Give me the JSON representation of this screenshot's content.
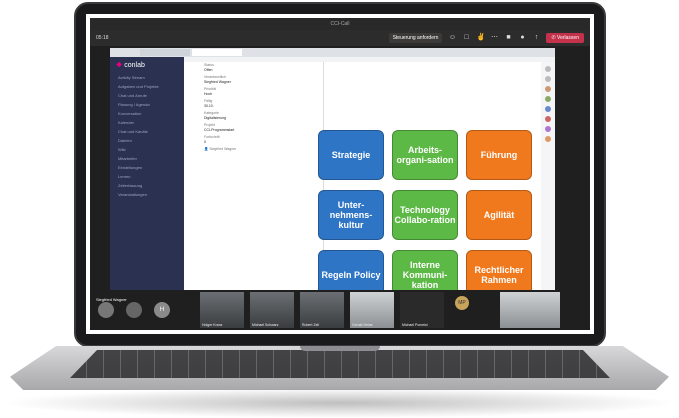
{
  "window": {
    "title": "CCI-Call"
  },
  "meeting_bar": {
    "timer": "05:18",
    "request_control_label": "Steuerung anfordern",
    "leave_label": "Verlassen"
  },
  "conlab": {
    "logo": "conlab",
    "nav_items": [
      "Activity Stream",
      "Aufgaben und Projekte",
      "Chat und Anrufe",
      "Planung / Agenda",
      "Konversation",
      "Kalender",
      "Chat und Kanäle",
      "Dateien",
      "Wiki",
      "Mitarbeiter",
      "Einstellungen",
      "Lernen",
      "Zeiterfassung",
      "Veranstaltungen"
    ]
  },
  "panel": {
    "rows": [
      {
        "label": "Status",
        "value": "Offen"
      },
      {
        "label": "Verantwortlich",
        "value": "Siegfried Wagner"
      },
      {
        "label": "Priorität",
        "value": "Hoch"
      },
      {
        "label": "Fällig",
        "value": "30.10."
      },
      {
        "label": "Kategorie",
        "value": "Digitalisierung"
      },
      {
        "label": "Projekt",
        "value": "CCI-Programmstart"
      },
      {
        "label": "Fortschritt",
        "value": "0"
      }
    ],
    "assignee": "Siegfried Wagner"
  },
  "slide": {
    "tiles": [
      {
        "text": "Strategie",
        "color": "#2e75c5"
      },
      {
        "text": "Arbeits-organi-sation",
        "color": "#5db945"
      },
      {
        "text": "Führung",
        "color": "#f0791d"
      },
      {
        "text": "Unter-nehmens-kultur",
        "color": "#2e75c5"
      },
      {
        "text": "Technology Collabo-ration",
        "color": "#5db945"
      },
      {
        "text": "Agilität",
        "color": "#f0791d"
      },
      {
        "text": "Regeln Policy",
        "color": "#2e75c5"
      },
      {
        "text": "Interne Kommuni-kation",
        "color": "#5db945"
      },
      {
        "text": "Rechtlicher Rahmen",
        "color": "#f0791d"
      }
    ]
  },
  "presenter": {
    "name": "Siegfried Wagner"
  },
  "participants": {
    "avatar_initial": "H",
    "mp_initials": "MP",
    "names": [
      "Holger Kranz",
      "Michael Schwarz",
      "Robert Zeil",
      "Gerald Heine",
      "Michael Pomeisl",
      ""
    ]
  }
}
